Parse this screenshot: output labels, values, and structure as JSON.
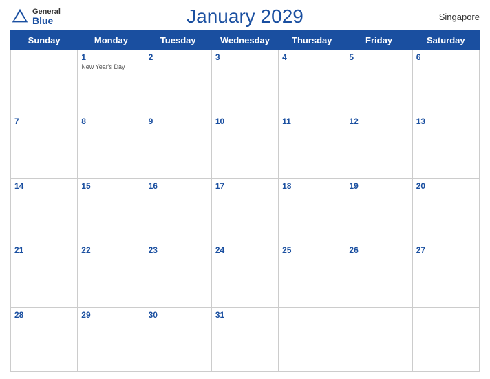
{
  "header": {
    "logo_general": "General",
    "logo_blue": "Blue",
    "title": "January 2029",
    "country": "Singapore"
  },
  "days_of_week": [
    "Sunday",
    "Monday",
    "Tuesday",
    "Wednesday",
    "Thursday",
    "Friday",
    "Saturday"
  ],
  "weeks": [
    [
      {
        "day": "",
        "holiday": ""
      },
      {
        "day": "1",
        "holiday": "New Year's Day"
      },
      {
        "day": "2",
        "holiday": ""
      },
      {
        "day": "3",
        "holiday": ""
      },
      {
        "day": "4",
        "holiday": ""
      },
      {
        "day": "5",
        "holiday": ""
      },
      {
        "day": "6",
        "holiday": ""
      }
    ],
    [
      {
        "day": "7",
        "holiday": ""
      },
      {
        "day": "8",
        "holiday": ""
      },
      {
        "day": "9",
        "holiday": ""
      },
      {
        "day": "10",
        "holiday": ""
      },
      {
        "day": "11",
        "holiday": ""
      },
      {
        "day": "12",
        "holiday": ""
      },
      {
        "day": "13",
        "holiday": ""
      }
    ],
    [
      {
        "day": "14",
        "holiday": ""
      },
      {
        "day": "15",
        "holiday": ""
      },
      {
        "day": "16",
        "holiday": ""
      },
      {
        "day": "17",
        "holiday": ""
      },
      {
        "day": "18",
        "holiday": ""
      },
      {
        "day": "19",
        "holiday": ""
      },
      {
        "day": "20",
        "holiday": ""
      }
    ],
    [
      {
        "day": "21",
        "holiday": ""
      },
      {
        "day": "22",
        "holiday": ""
      },
      {
        "day": "23",
        "holiday": ""
      },
      {
        "day": "24",
        "holiday": ""
      },
      {
        "day": "25",
        "holiday": ""
      },
      {
        "day": "26",
        "holiday": ""
      },
      {
        "day": "27",
        "holiday": ""
      }
    ],
    [
      {
        "day": "28",
        "holiday": ""
      },
      {
        "day": "29",
        "holiday": ""
      },
      {
        "day": "30",
        "holiday": ""
      },
      {
        "day": "31",
        "holiday": ""
      },
      {
        "day": "",
        "holiday": ""
      },
      {
        "day": "",
        "holiday": ""
      },
      {
        "day": "",
        "holiday": ""
      }
    ]
  ]
}
